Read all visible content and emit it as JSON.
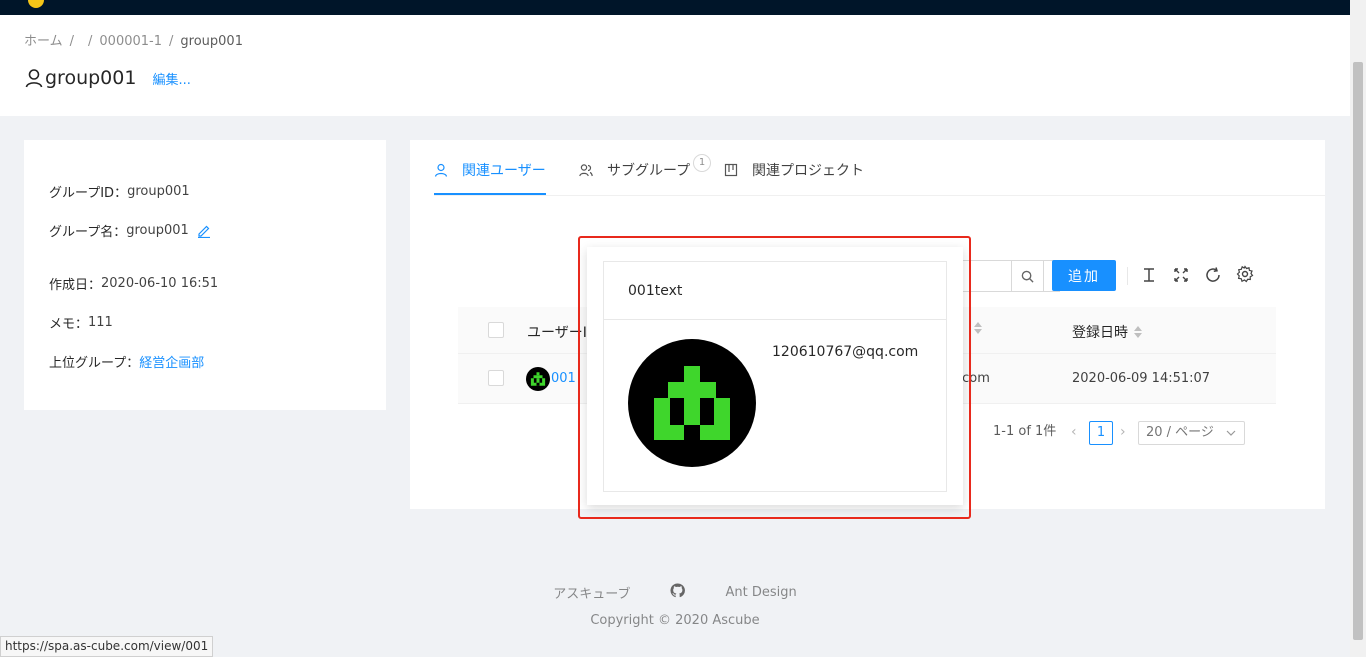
{
  "breadcrumb": {
    "home": "ホーム",
    "sep1": "/",
    "sep2": "/",
    "item2": "000001-1",
    "sep3": "/",
    "current": "group001"
  },
  "page": {
    "title": "group001",
    "edit": "編集..."
  },
  "info": {
    "group_id_label": "グループID：",
    "group_id": "group001",
    "group_name_label": "グループ名：",
    "group_name": "group001",
    "created_label": "作成日：",
    "created": "2020-06-10 16:51",
    "memo_label": "メモ：",
    "memo": "111",
    "parent_label": "上位グループ：",
    "parent": "経営企画部"
  },
  "tabs": [
    {
      "label": "関連ユーザー"
    },
    {
      "label": "サブグループ",
      "badge": "1"
    },
    {
      "label": "関連プロジェクト"
    }
  ],
  "toolbar": {
    "add": "追加"
  },
  "table": {
    "col_user": "ユーザーI",
    "col_date": "登録日時",
    "row": {
      "user": "001",
      "email_tail": ".com",
      "date": "2020-06-09 14:51:07"
    }
  },
  "pagination": {
    "total": "1-1 of 1件",
    "page": "1",
    "size": "20 / ページ"
  },
  "popover": {
    "title": "001text",
    "email": "120610767@qq.com"
  },
  "footer": {
    "link1": "アスキューブ",
    "link3": "Ant Design",
    "copyright": "Copyright",
    "copyright_year": "2020 Ascube"
  },
  "status_url": "https://spa.as-cube.com/view/001",
  "colors": {
    "primary": "#1890ff",
    "header": "#001529",
    "highlight": "#e8291c",
    "avatar_green": "#3fd62c"
  }
}
